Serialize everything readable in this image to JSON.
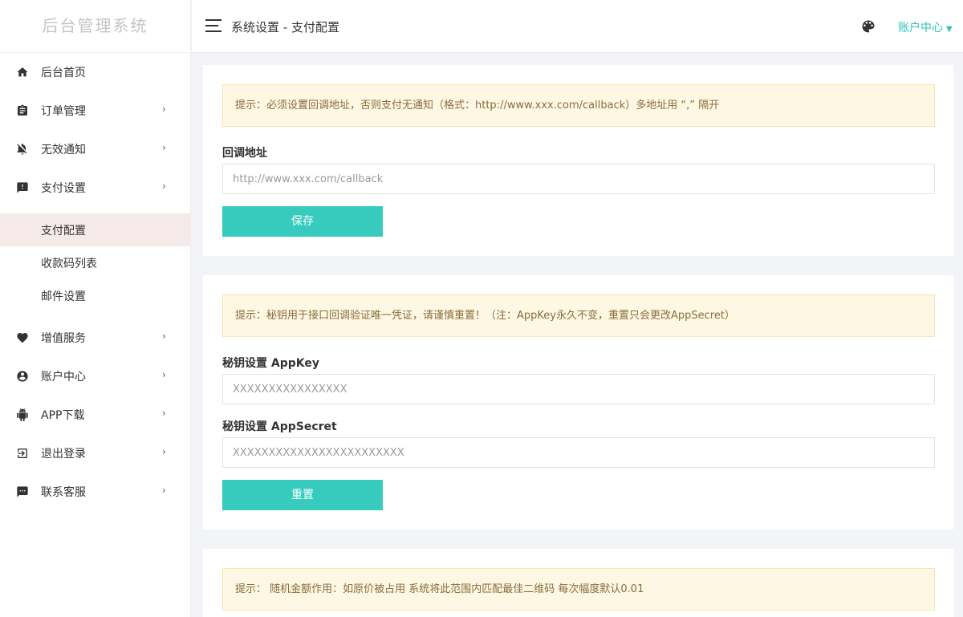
{
  "app": {
    "logo": "后台管理系统"
  },
  "header": {
    "title": "系统设置 - 支付配置",
    "account_menu": "账户中心",
    "caret": "▼"
  },
  "sidebar": {
    "items": [
      {
        "label": "后台首页",
        "icon": "home-icon"
      },
      {
        "label": "订单管理",
        "icon": "clipboard-icon",
        "arrow": "›"
      },
      {
        "label": "无效通知",
        "icon": "bell-off-icon",
        "arrow": "›"
      },
      {
        "label": "支付设置",
        "icon": "payment-icon",
        "arrow": "›"
      },
      {
        "label": "增值服务",
        "icon": "heart-icon",
        "arrow": "›"
      },
      {
        "label": "账户中心",
        "icon": "user-circle-icon",
        "arrow": "›"
      },
      {
        "label": "APP下载",
        "icon": "android-icon",
        "arrow": "›"
      },
      {
        "label": "退出登录",
        "icon": "logout-icon",
        "arrow": "›"
      },
      {
        "label": "联系客服",
        "icon": "chat-icon",
        "arrow": "›"
      }
    ],
    "submenu": [
      {
        "label": "支付配置",
        "active": true
      },
      {
        "label": "收款码列表"
      },
      {
        "label": "邮件设置"
      }
    ]
  },
  "callback_section": {
    "tip": "提示：必须设置回调地址，否则支付无通知（格式：http://www.xxx.com/callback）多地址用 “,” 隔开",
    "label": "回调地址",
    "placeholder": "http://www.xxx.com/callback",
    "save_label": "保存"
  },
  "secret_section": {
    "tip": "提示：秘钥用于接口回调验证唯一凭证，请谨慎重置！（注：AppKey永久不变，重置只会更改AppSecret）",
    "appkey_label": "秘钥设置 AppKey",
    "appkey_placeholder": "XXXXXXXXXXXXXXXX",
    "appsecret_label": "秘钥设置 AppSecret",
    "appsecret_placeholder": "XXXXXXXXXXXXXXXXXXXXXXXX",
    "reset_label": "重置"
  },
  "random_section": {
    "tip": "提示：  随机金额作用：如原价被占用 系统将此范围内匹配最佳二维码 每次幅度默认0.01"
  },
  "colors": {
    "accent": "#36cbbd",
    "tip_bg": "#fdf7e3",
    "tip_text": "#8a6d3b",
    "active_bg": "#f5e9ea"
  }
}
